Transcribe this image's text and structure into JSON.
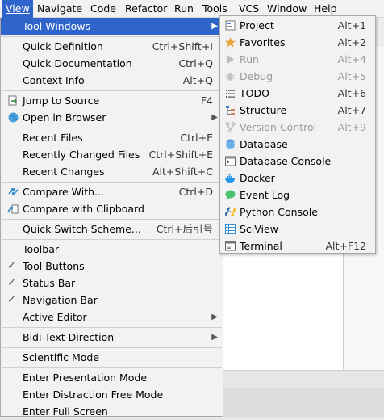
{
  "menubar": {
    "items": [
      {
        "label": "View",
        "mnemonic": "V",
        "active": true
      },
      {
        "label": "Navigate",
        "mnemonic": "N"
      },
      {
        "label": "Code",
        "mnemonic": "C"
      },
      {
        "label": "Refactor",
        "mnemonic": "R"
      },
      {
        "label": "Run",
        "mnemonic": "u"
      },
      {
        "label": "Tools",
        "mnemonic": "T"
      },
      {
        "label": "VCS",
        "mnemonic": "S"
      },
      {
        "label": "Window",
        "mnemonic": "W"
      },
      {
        "label": "Help",
        "mnemonic": "H"
      }
    ]
  },
  "view_menu": {
    "items": [
      {
        "label": "Tool Windows",
        "shortcut": "",
        "submenu": true,
        "selected": true
      },
      {
        "label": "Quick Definition",
        "shortcut": "Ctrl+Shift+I"
      },
      {
        "label": "Quick Documentation",
        "shortcut": "Ctrl+Q"
      },
      {
        "label": "Context Info",
        "shortcut": "Alt+Q"
      },
      {
        "label": "Jump to Source",
        "shortcut": "F4",
        "icon": "jump-to-source-icon"
      },
      {
        "label": "Open in Browser",
        "shortcut": "",
        "submenu": true,
        "icon": "globe-icon"
      },
      {
        "label": "Recent Files",
        "shortcut": "Ctrl+E"
      },
      {
        "label": "Recently Changed Files",
        "shortcut": "Ctrl+Shift+E"
      },
      {
        "label": "Recent Changes",
        "shortcut": "Alt+Shift+C"
      },
      {
        "label": "Compare With...",
        "shortcut": "Ctrl+D",
        "icon": "compare-icon"
      },
      {
        "label": "Compare with Clipboard",
        "shortcut": "",
        "icon": "compare-clipboard-icon"
      },
      {
        "label": "Quick Switch Scheme...",
        "shortcut": "Ctrl+后引号"
      },
      {
        "label": "Toolbar",
        "shortcut": ""
      },
      {
        "label": "Tool Buttons",
        "shortcut": "",
        "checked": true
      },
      {
        "label": "Status Bar",
        "shortcut": "",
        "checked": true
      },
      {
        "label": "Navigation Bar",
        "shortcut": "",
        "checked": true
      },
      {
        "label": "Active Editor",
        "shortcut": "",
        "submenu": true
      },
      {
        "label": "Bidi Text Direction",
        "shortcut": "",
        "submenu": true
      },
      {
        "label": "Scientific Mode",
        "shortcut": ""
      },
      {
        "label": "Enter Presentation Mode",
        "shortcut": ""
      },
      {
        "label": "Enter Distraction Free Mode",
        "shortcut": ""
      },
      {
        "label": "Enter Full Screen",
        "shortcut": ""
      }
    ]
  },
  "tool_windows_menu": {
    "items": [
      {
        "label": "Project",
        "shortcut": "Alt+1",
        "icon": "project-icon"
      },
      {
        "label": "Favorites",
        "shortcut": "Alt+2",
        "icon": "favorites-star-icon"
      },
      {
        "label": "Run",
        "shortcut": "Alt+4",
        "icon": "run-icon",
        "disabled": true
      },
      {
        "label": "Debug",
        "shortcut": "Alt+5",
        "icon": "debug-icon",
        "disabled": true
      },
      {
        "label": "TODO",
        "shortcut": "Alt+6",
        "icon": "todo-icon"
      },
      {
        "label": "Structure",
        "shortcut": "Alt+7",
        "icon": "structure-icon"
      },
      {
        "label": "Version Control",
        "shortcut": "Alt+9",
        "icon": "version-control-icon",
        "disabled": true
      },
      {
        "label": "Database",
        "shortcut": "",
        "icon": "database-icon"
      },
      {
        "label": "Database Console",
        "shortcut": "",
        "icon": "database-console-icon"
      },
      {
        "label": "Docker",
        "shortcut": "",
        "icon": "docker-icon"
      },
      {
        "label": "Event Log",
        "shortcut": "",
        "icon": "event-log-icon"
      },
      {
        "label": "Python Console",
        "shortcut": "",
        "icon": "python-console-icon"
      },
      {
        "label": "SciView",
        "shortcut": "",
        "icon": "sciview-icon"
      },
      {
        "label": "Terminal",
        "shortcut": "Alt+F12",
        "icon": "terminal-icon"
      }
    ]
  },
  "colors": {
    "selection": "#2f65ca",
    "menu_bg": "#f2f2f2",
    "disabled_text": "#9a9a9a"
  }
}
